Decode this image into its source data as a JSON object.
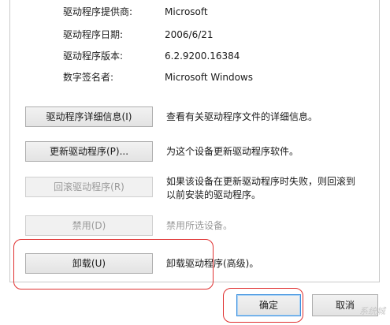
{
  "driver_info": [
    {
      "label": "驱动程序提供商:",
      "value": "Microsoft"
    },
    {
      "label": "驱动程序日期:",
      "value": "2006/6/21"
    },
    {
      "label": "驱动程序版本:",
      "value": "6.2.9200.16384"
    },
    {
      "label": "数字签名者:",
      "value": "Microsoft Windows"
    }
  ],
  "actions": {
    "details": {
      "label": "驱动程序详细信息(I)",
      "desc": "查看有关驱动程序文件的详细信息。"
    },
    "update": {
      "label": "更新驱动程序(P)...",
      "desc": "为这个设备更新驱动程序软件。"
    },
    "rollback": {
      "label": "回滚驱动程序(R)",
      "desc_line1": "如果该设备在更新驱动程序时失败，则回滚到",
      "desc_line2": "以前安装的驱动程序。"
    },
    "disable": {
      "label": "禁用(D)",
      "desc": "禁用所选设备。"
    },
    "uninstall": {
      "label": "卸载(U)",
      "desc": "卸载驱动程序(高级)。"
    }
  },
  "footer": {
    "ok_label": "确定",
    "cancel_label": "取消"
  },
  "watermark": "系统城"
}
